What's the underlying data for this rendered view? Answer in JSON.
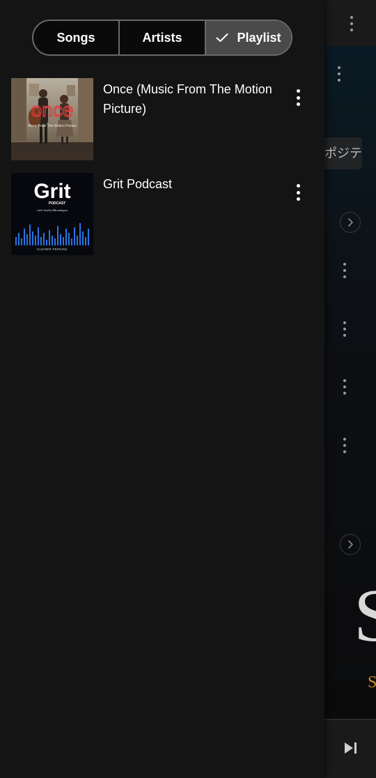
{
  "tabs": [
    {
      "label": "Songs",
      "active": false
    },
    {
      "label": "Artists",
      "active": false
    },
    {
      "label": "Playlist",
      "active": true
    }
  ],
  "playlists": [
    {
      "title": "Once (Music From The Motion Picture)",
      "art_text": "once",
      "art_subtext": "Music From The Motion Picture"
    },
    {
      "title": "Grit Podcast",
      "art_text": "Grit",
      "art_subtext": "PODCAST",
      "art_tagline": "with Joubin Mirzadegan",
      "art_footer": "KLEINER PERKINS"
    }
  ],
  "background": {
    "chip_text": "ポジティ"
  },
  "icons": {
    "check": "check-icon",
    "more": "more-vert-icon",
    "chevron": "chevron-right-icon",
    "skip_next": "skip-next-icon"
  },
  "colors": {
    "drawer_bg": "#141414",
    "segment_active": "#4a4a4a",
    "segment_border": "#6a6a6a"
  }
}
